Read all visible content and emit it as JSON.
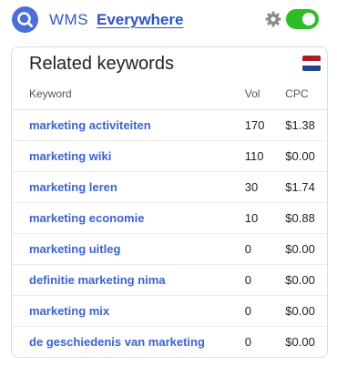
{
  "header": {
    "brand": "WMS",
    "brand_link": "Everywhere",
    "icons": {
      "logo": "search-icon",
      "settings": "gear-icon"
    },
    "toggle_on": true,
    "colors": {
      "brand": "#3558c2",
      "toggle": "#2dbd24"
    }
  },
  "card": {
    "title": "Related keywords",
    "flag": "netherlands-flag",
    "flag_colors": [
      "#ae1c28",
      "#ffffff",
      "#21468b"
    ],
    "columns": {
      "keyword": "Keyword",
      "vol": "Vol",
      "cpc": "CPC"
    },
    "rows": [
      {
        "keyword": "marketing activiteiten",
        "vol": "170",
        "cpc": "$1.38"
      },
      {
        "keyword": "marketing wiki",
        "vol": "110",
        "cpc": "$0.00"
      },
      {
        "keyword": "marketing leren",
        "vol": "30",
        "cpc": "$1.74"
      },
      {
        "keyword": "marketing economie",
        "vol": "10",
        "cpc": "$0.88"
      },
      {
        "keyword": "marketing uitleg",
        "vol": "0",
        "cpc": "$0.00"
      },
      {
        "keyword": "definitie marketing nima",
        "vol": "0",
        "cpc": "$0.00"
      },
      {
        "keyword": "marketing mix",
        "vol": "0",
        "cpc": "$0.00"
      },
      {
        "keyword": "de geschiedenis van marketing",
        "vol": "0",
        "cpc": "$0.00"
      }
    ]
  }
}
